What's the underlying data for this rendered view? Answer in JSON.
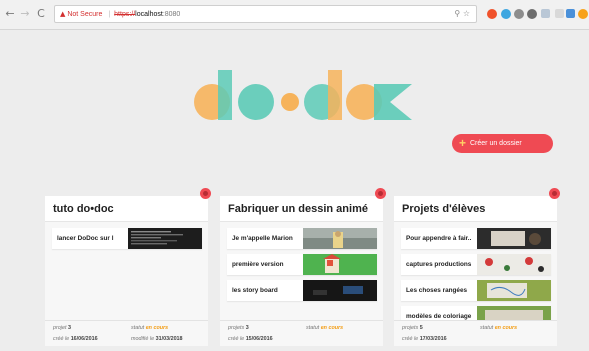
{
  "browser": {
    "back_glyph": "←",
    "forward_glyph": "→",
    "reload_glyph": "C",
    "warning_glyph": "▲",
    "not_secure": "Not Secure",
    "separator": "|",
    "protocol": "https://",
    "host": "localhost",
    "port": ":8080",
    "search_glyph": "⚲",
    "star_glyph": "☆"
  },
  "app": {
    "create_plus": "+",
    "create_label": "Créer un dossier"
  },
  "folders": [
    {
      "title": "tuto do•doc",
      "items": [
        {
          "label": "lancer DoDoc sur l"
        }
      ],
      "projects_word": "projet",
      "projects_count": "3",
      "status_word": "statut",
      "status_value": "en cours",
      "created_word": "créé le",
      "created_date": "16/06/2016",
      "modified_word": "modifié le",
      "modified_date": "31/03/2018"
    },
    {
      "title": "Fabriquer un dessin animé",
      "items": [
        {
          "label": "Je m'appelle Marion"
        },
        {
          "label": "première version"
        },
        {
          "label": "les story board"
        }
      ],
      "projects_word": "projets",
      "projects_count": "3",
      "status_word": "statut",
      "status_value": "en cours",
      "created_word": "créé le",
      "created_date": "15/06/2016"
    },
    {
      "title": "Projets d'élèves",
      "items": [
        {
          "label": "Pour appendre à fair.."
        },
        {
          "label": "captures productions"
        },
        {
          "label": "Les choses rangées"
        },
        {
          "label": "modèles de coloriage"
        }
      ],
      "projects_word": "projets",
      "projects_count": "5",
      "status_word": "statut",
      "status_value": "en cours",
      "created_word": "créé le",
      "created_date": "17/03/2016"
    }
  ],
  "colors": {
    "accent_red": "#ef4a53",
    "logo_orange": "#f6b35b",
    "logo_teal": "#5ccab6",
    "status_orange": "#f39c12"
  }
}
